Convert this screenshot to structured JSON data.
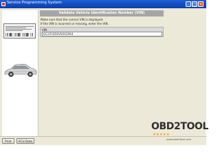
{
  "window": {
    "title": "Service Programming System"
  },
  "header": {
    "title": "Validate Vehicle Identification Number (VIN)"
  },
  "instructions": {
    "text": "Make sure that the correct VIN is displayed.\nIf the VIN is incorrect or missing, enter the VIN."
  },
  "vin": {
    "label": "VIN",
    "value": "6G1P1SR6VE002964"
  },
  "footer": {
    "print_label": "Print",
    "ecu_label": "ECU Data"
  },
  "watermark": {
    "brand": "OBD2TOOL",
    "stars": "★★★★★",
    "url": "www.obd2tool.com"
  },
  "colors": {
    "titlebar": "#0a3fa8",
    "panel_bg": "#ece9d8",
    "header_bg": "#a5a5a5",
    "star": "#f1a51c"
  }
}
